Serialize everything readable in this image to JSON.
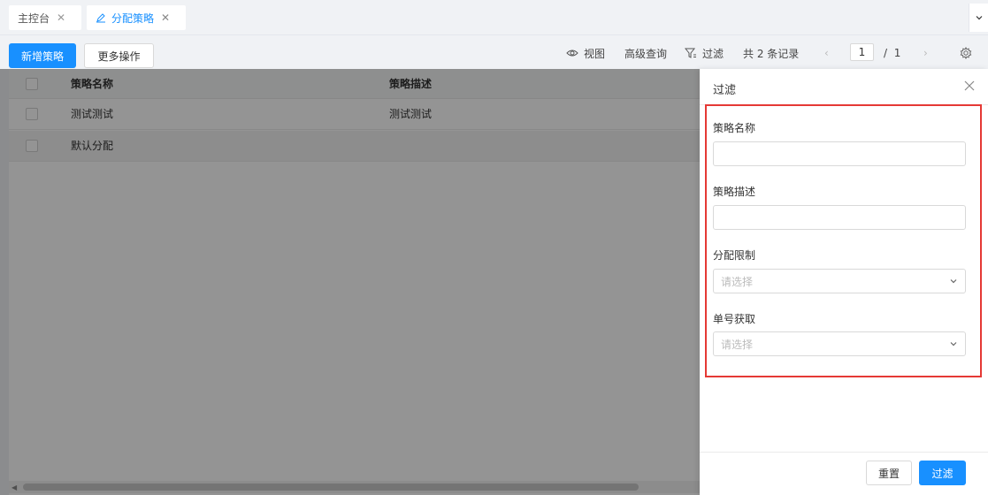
{
  "tabs": [
    {
      "label": "主控台",
      "active": false
    },
    {
      "label": "分配策略",
      "active": true
    }
  ],
  "toolbar": {
    "add_label": "新增策略",
    "more_label": "更多操作",
    "view_label": "视图",
    "advanced_label": "高级查询",
    "filter_label": "过滤",
    "total_text": "共 2 条记录",
    "page_current": "1",
    "page_sep": "/",
    "page_total": "1"
  },
  "table": {
    "columns": [
      "策略名称",
      "策略描述"
    ],
    "rows": [
      [
        "测试测试",
        "测试测试"
      ],
      [
        "默认分配",
        ""
      ]
    ]
  },
  "drawer": {
    "title": "过滤",
    "fields": [
      {
        "label": "策略名称",
        "type": "input",
        "value": ""
      },
      {
        "label": "策略描述",
        "type": "input",
        "value": ""
      },
      {
        "label": "分配限制",
        "type": "select",
        "placeholder": "请选择"
      },
      {
        "label": "单号获取",
        "type": "select",
        "placeholder": "请选择"
      }
    ],
    "reset_label": "重置",
    "submit_label": "过滤"
  },
  "colors": {
    "primary": "#1890ff",
    "highlight": "#e53935"
  }
}
